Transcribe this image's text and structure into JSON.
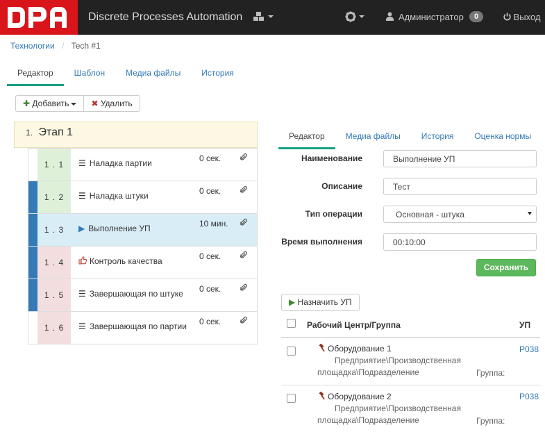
{
  "logo": {
    "text": "DPA"
  },
  "navbar": {
    "brand": "Discrete Processes Automation",
    "user": "Администратор",
    "badge": "0",
    "logout": "Выход"
  },
  "breadcrumb": {
    "root": "Технологии",
    "current": "Tech #1"
  },
  "main_tabs": [
    "Редактор",
    "Шаблон",
    "Медиа файлы",
    "История"
  ],
  "toolbar": {
    "add": "Добавить",
    "delete": "Удалить"
  },
  "stage": {
    "num": "1.",
    "title": "Этап 1"
  },
  "operations": [
    {
      "num": "1 . 1",
      "name": "Наладка партии",
      "time": "0 сек.",
      "icon": "list-icon",
      "marker": ""
    },
    {
      "num": "1 . 2",
      "name": "Наладка штуки",
      "time": "0 сек.",
      "icon": "list-icon",
      "marker": "#337ab7"
    },
    {
      "num": "1 . 3",
      "name": "Выполнение УП",
      "time": "10 мин.",
      "icon": "play-icon",
      "marker": "#337ab7"
    },
    {
      "num": "1 . 4",
      "name": "Контроль качества",
      "time": "0 сек.",
      "icon": "thumb-icon",
      "marker": "#337ab7"
    },
    {
      "num": "1 . 5",
      "name": "Завершающая по штуке",
      "time": "0 сек.",
      "icon": "list-icon",
      "marker": "#337ab7"
    },
    {
      "num": "1 . 6",
      "name": "Завершающая по партии",
      "time": "0 сек.",
      "icon": "list-icon",
      "marker": ""
    }
  ],
  "right_tabs": [
    "Редактор",
    "Медиа файлы",
    "История",
    "Оценка нормы"
  ],
  "form": {
    "name_label": "Наименование",
    "name_value": "Выполнение УП",
    "desc_label": "Описание",
    "desc_value": "Тест",
    "type_label": "Тип операции",
    "type_value": "Основная - штука",
    "time_label": "Время выполнения",
    "time_value": "00:10:00",
    "save": "Сохранить"
  },
  "assign_button": "Назначить УП",
  "table": {
    "col_wc": "Рабочий Центр/Группа",
    "col_up": "УП",
    "rows": [
      {
        "name": "Оборудование 1",
        "path1": "Предприятие\\Производственная",
        "path2": "площадка\\Подразделение",
        "group": "Группа:",
        "up": "P038"
      },
      {
        "name": "Оборудование 2",
        "path1": "Предприятие\\Производственная",
        "path2": "площадка\\Подразделение",
        "group": "Группа:",
        "up": "P038"
      }
    ]
  },
  "colors": {
    "accent": "#16a085",
    "link": "#337ab7",
    "logo": "#d9141b",
    "save": "#5cb85c",
    "stage_bg": "#fcf8e3",
    "op_green": "#dff0d8",
    "op_red": "#f2dede",
    "op_selected": "#d9edf7"
  }
}
